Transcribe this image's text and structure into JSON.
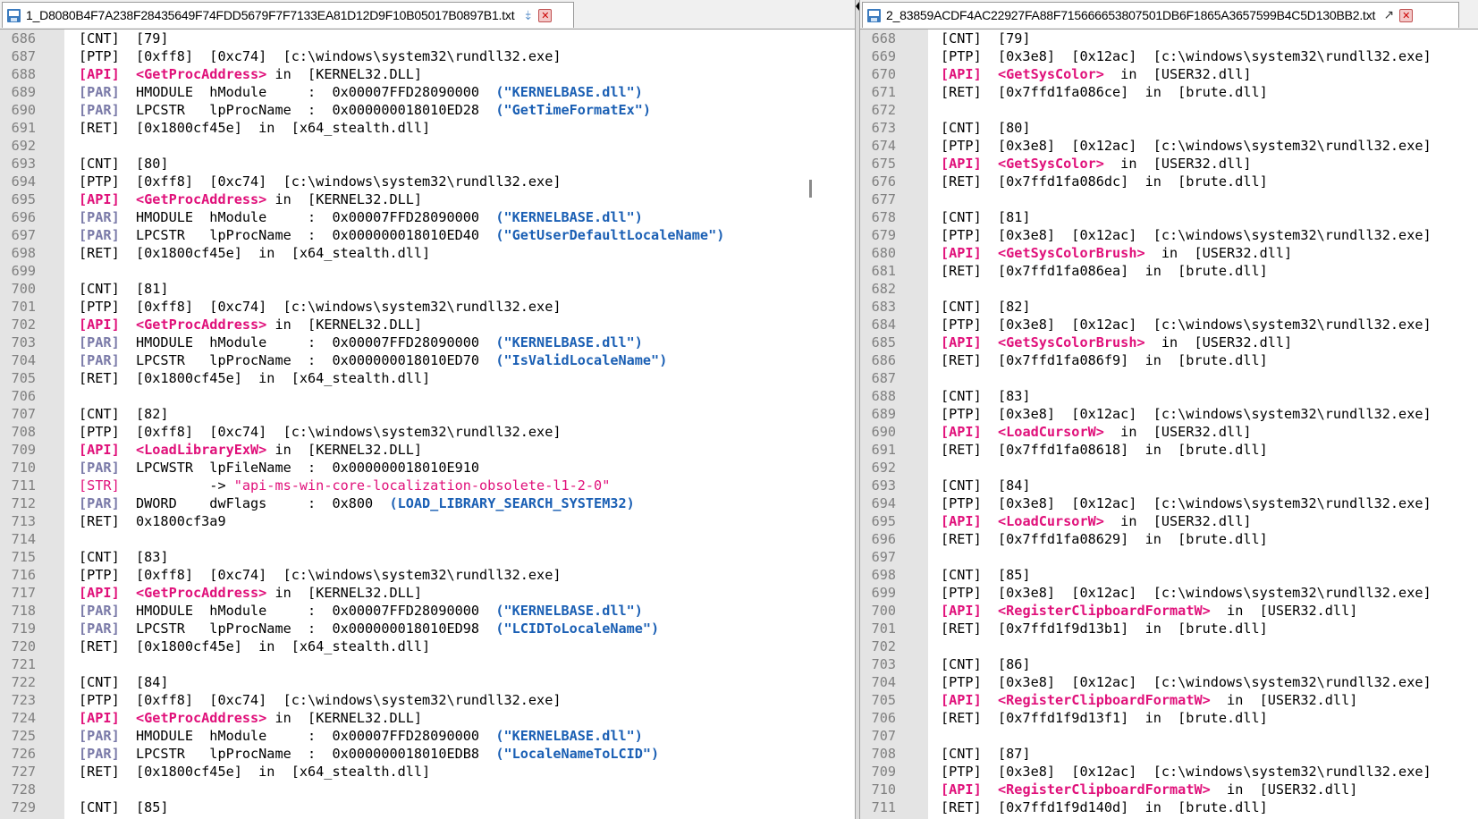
{
  "left": {
    "tab_title": "1_D8080B4F7A238F28435649F74FDD5679F7F7133EA81D12D9F10B05017B0897B1.txt",
    "lines": [
      {
        "n": "686",
        "segs": [
          [
            "t",
            "[CNT]  [79]"
          ]
        ]
      },
      {
        "n": "687",
        "segs": [
          [
            "t",
            "[PTP]  [0xff8]  [0xc74]  [c:\\windows\\system32\\rundll32.exe]"
          ]
        ]
      },
      {
        "n": "688",
        "segs": [
          [
            "api",
            "[API]"
          ],
          [
            "t",
            "  "
          ],
          [
            "fn",
            "<GetProcAddress>"
          ],
          [
            "t",
            " in  [KERNEL32.DLL]"
          ]
        ]
      },
      {
        "n": "689",
        "segs": [
          [
            "par",
            "[PAR]"
          ],
          [
            "t",
            "  HMODULE  hModule     :  0x00007FFD28090000  "
          ],
          [
            "val",
            "(\"KERNELBASE.dll\")"
          ]
        ]
      },
      {
        "n": "690",
        "segs": [
          [
            "par",
            "[PAR]"
          ],
          [
            "t",
            "  LPCSTR   lpProcName  :  0x000000018010ED28  "
          ],
          [
            "val",
            "(\"GetTimeFormatEx\")"
          ]
        ]
      },
      {
        "n": "691",
        "segs": [
          [
            "t",
            "[RET]  [0x1800cf45e]  in  [x64_stealth.dll]"
          ]
        ]
      },
      {
        "n": "692",
        "segs": []
      },
      {
        "n": "693",
        "segs": [
          [
            "t",
            "[CNT]  [80]"
          ]
        ]
      },
      {
        "n": "694",
        "segs": [
          [
            "t",
            "[PTP]  [0xff8]  [0xc74]  [c:\\windows\\system32\\rundll32.exe]"
          ]
        ]
      },
      {
        "n": "695",
        "segs": [
          [
            "api",
            "[API]"
          ],
          [
            "t",
            "  "
          ],
          [
            "fn",
            "<GetProcAddress>"
          ],
          [
            "t",
            " in  [KERNEL32.DLL]"
          ]
        ]
      },
      {
        "n": "696",
        "segs": [
          [
            "par",
            "[PAR]"
          ],
          [
            "t",
            "  HMODULE  hModule     :  0x00007FFD28090000  "
          ],
          [
            "val",
            "(\"KERNELBASE.dll\")"
          ]
        ]
      },
      {
        "n": "697",
        "segs": [
          [
            "par",
            "[PAR]"
          ],
          [
            "t",
            "  LPCSTR   lpProcName  :  0x000000018010ED40  "
          ],
          [
            "val",
            "(\"GetUserDefaultLocaleName\")"
          ]
        ]
      },
      {
        "n": "698",
        "segs": [
          [
            "t",
            "[RET]  [0x1800cf45e]  in  [x64_stealth.dll]"
          ]
        ]
      },
      {
        "n": "699",
        "segs": []
      },
      {
        "n": "700",
        "segs": [
          [
            "t",
            "[CNT]  [81]"
          ]
        ]
      },
      {
        "n": "701",
        "segs": [
          [
            "t",
            "[PTP]  [0xff8]  [0xc74]  [c:\\windows\\system32\\rundll32.exe]"
          ]
        ]
      },
      {
        "n": "702",
        "segs": [
          [
            "api",
            "[API]"
          ],
          [
            "t",
            "  "
          ],
          [
            "fn",
            "<GetProcAddress>"
          ],
          [
            "t",
            " in  [KERNEL32.DLL]"
          ]
        ]
      },
      {
        "n": "703",
        "segs": [
          [
            "par",
            "[PAR]"
          ],
          [
            "t",
            "  HMODULE  hModule     :  0x00007FFD28090000  "
          ],
          [
            "val",
            "(\"KERNELBASE.dll\")"
          ]
        ]
      },
      {
        "n": "704",
        "segs": [
          [
            "par",
            "[PAR]"
          ],
          [
            "t",
            "  LPCSTR   lpProcName  :  0x000000018010ED70  "
          ],
          [
            "val",
            "(\"IsValidLocaleName\")"
          ]
        ]
      },
      {
        "n": "705",
        "segs": [
          [
            "t",
            "[RET]  [0x1800cf45e]  in  [x64_stealth.dll]"
          ]
        ]
      },
      {
        "n": "706",
        "segs": []
      },
      {
        "n": "707",
        "segs": [
          [
            "t",
            "[CNT]  [82]"
          ]
        ]
      },
      {
        "n": "708",
        "segs": [
          [
            "t",
            "[PTP]  [0xff8]  [0xc74]  [c:\\windows\\system32\\rundll32.exe]"
          ]
        ]
      },
      {
        "n": "709",
        "segs": [
          [
            "api",
            "[API]"
          ],
          [
            "t",
            "  "
          ],
          [
            "fn",
            "<LoadLibraryExW>"
          ],
          [
            "t",
            " in  [KERNEL32.DLL]"
          ]
        ]
      },
      {
        "n": "710",
        "segs": [
          [
            "par",
            "[PAR]"
          ],
          [
            "t",
            "  LPCWSTR  lpFileName  :  0x000000018010E910"
          ]
        ]
      },
      {
        "n": "711",
        "segs": [
          [
            "str",
            "[STR]"
          ],
          [
            "t",
            "           -> "
          ],
          [
            "strv",
            "\"api-ms-win-core-localization-obsolete-l1-2-0\""
          ]
        ]
      },
      {
        "n": "712",
        "segs": [
          [
            "par",
            "[PAR]"
          ],
          [
            "t",
            "  DWORD    dwFlags     :  0x800  "
          ],
          [
            "val",
            "(LOAD_LIBRARY_SEARCH_SYSTEM32)"
          ]
        ]
      },
      {
        "n": "713",
        "segs": [
          [
            "t",
            "[RET]  0x1800cf3a9"
          ]
        ]
      },
      {
        "n": "714",
        "segs": []
      },
      {
        "n": "715",
        "segs": [
          [
            "t",
            "[CNT]  [83]"
          ]
        ]
      },
      {
        "n": "716",
        "segs": [
          [
            "t",
            "[PTP]  [0xff8]  [0xc74]  [c:\\windows\\system32\\rundll32.exe]"
          ]
        ]
      },
      {
        "n": "717",
        "segs": [
          [
            "api",
            "[API]"
          ],
          [
            "t",
            "  "
          ],
          [
            "fn",
            "<GetProcAddress>"
          ],
          [
            "t",
            " in  [KERNEL32.DLL]"
          ]
        ]
      },
      {
        "n": "718",
        "segs": [
          [
            "par",
            "[PAR]"
          ],
          [
            "t",
            "  HMODULE  hModule     :  0x00007FFD28090000  "
          ],
          [
            "val",
            "(\"KERNELBASE.dll\")"
          ]
        ]
      },
      {
        "n": "719",
        "segs": [
          [
            "par",
            "[PAR]"
          ],
          [
            "t",
            "  LPCSTR   lpProcName  :  0x000000018010ED98  "
          ],
          [
            "val",
            "(\"LCIDToLocaleName\")"
          ]
        ]
      },
      {
        "n": "720",
        "segs": [
          [
            "t",
            "[RET]  [0x1800cf45e]  in  [x64_stealth.dll]"
          ]
        ]
      },
      {
        "n": "721",
        "segs": []
      },
      {
        "n": "722",
        "segs": [
          [
            "t",
            "[CNT]  [84]"
          ]
        ]
      },
      {
        "n": "723",
        "segs": [
          [
            "t",
            "[PTP]  [0xff8]  [0xc74]  [c:\\windows\\system32\\rundll32.exe]"
          ]
        ]
      },
      {
        "n": "724",
        "segs": [
          [
            "api",
            "[API]"
          ],
          [
            "t",
            "  "
          ],
          [
            "fn",
            "<GetProcAddress>"
          ],
          [
            "t",
            " in  [KERNEL32.DLL]"
          ]
        ]
      },
      {
        "n": "725",
        "segs": [
          [
            "par",
            "[PAR]"
          ],
          [
            "t",
            "  HMODULE  hModule     :  0x00007FFD28090000  "
          ],
          [
            "val",
            "(\"KERNELBASE.dll\")"
          ]
        ]
      },
      {
        "n": "726",
        "segs": [
          [
            "par",
            "[PAR]"
          ],
          [
            "t",
            "  LPCSTR   lpProcName  :  0x000000018010EDB8  "
          ],
          [
            "val",
            "(\"LocaleNameToLCID\")"
          ]
        ]
      },
      {
        "n": "727",
        "segs": [
          [
            "t",
            "[RET]  [0x1800cf45e]  in  [x64_stealth.dll]"
          ]
        ]
      },
      {
        "n": "728",
        "segs": []
      },
      {
        "n": "729",
        "segs": [
          [
            "t",
            "[CNT]  [85]"
          ]
        ]
      }
    ]
  },
  "right": {
    "tab_title": "2_83859ACDF4AC22927FA88F715666653807501DB6F1865A3657599B4C5D130BB2.txt",
    "lines": [
      {
        "n": "668",
        "segs": [
          [
            "t",
            "[CNT]  [79]"
          ]
        ]
      },
      {
        "n": "669",
        "segs": [
          [
            "t",
            "[PTP]  [0x3e8]  [0x12ac]  [c:\\windows\\system32\\rundll32.exe]"
          ]
        ]
      },
      {
        "n": "670",
        "segs": [
          [
            "api",
            "[API]"
          ],
          [
            "t",
            "  "
          ],
          [
            "fn",
            "<GetSysColor>"
          ],
          [
            "t",
            "  in  [USER32.dll]"
          ]
        ]
      },
      {
        "n": "671",
        "segs": [
          [
            "t",
            "[RET]  [0x7ffd1fa086ce]  in  [brute.dll]"
          ]
        ]
      },
      {
        "n": "672",
        "segs": []
      },
      {
        "n": "673",
        "segs": [
          [
            "t",
            "[CNT]  [80]"
          ]
        ]
      },
      {
        "n": "674",
        "segs": [
          [
            "t",
            "[PTP]  [0x3e8]  [0x12ac]  [c:\\windows\\system32\\rundll32.exe]"
          ]
        ]
      },
      {
        "n": "675",
        "segs": [
          [
            "api",
            "[API]"
          ],
          [
            "t",
            "  "
          ],
          [
            "fn",
            "<GetSysColor>"
          ],
          [
            "t",
            "  in  [USER32.dll]"
          ]
        ]
      },
      {
        "n": "676",
        "segs": [
          [
            "t",
            "[RET]  [0x7ffd1fa086dc]  in  [brute.dll]"
          ]
        ]
      },
      {
        "n": "677",
        "segs": []
      },
      {
        "n": "678",
        "segs": [
          [
            "t",
            "[CNT]  [81]"
          ]
        ]
      },
      {
        "n": "679",
        "segs": [
          [
            "t",
            "[PTP]  [0x3e8]  [0x12ac]  [c:\\windows\\system32\\rundll32.exe]"
          ]
        ]
      },
      {
        "n": "680",
        "segs": [
          [
            "api",
            "[API]"
          ],
          [
            "t",
            "  "
          ],
          [
            "fn",
            "<GetSysColorBrush>"
          ],
          [
            "t",
            "  in  [USER32.dll]"
          ]
        ]
      },
      {
        "n": "681",
        "segs": [
          [
            "t",
            "[RET]  [0x7ffd1fa086ea]  in  [brute.dll]"
          ]
        ]
      },
      {
        "n": "682",
        "segs": []
      },
      {
        "n": "683",
        "segs": [
          [
            "t",
            "[CNT]  [82]"
          ]
        ]
      },
      {
        "n": "684",
        "segs": [
          [
            "t",
            "[PTP]  [0x3e8]  [0x12ac]  [c:\\windows\\system32\\rundll32.exe]"
          ]
        ]
      },
      {
        "n": "685",
        "segs": [
          [
            "api",
            "[API]"
          ],
          [
            "t",
            "  "
          ],
          [
            "fn",
            "<GetSysColorBrush>"
          ],
          [
            "t",
            "  in  [USER32.dll]"
          ]
        ]
      },
      {
        "n": "686",
        "segs": [
          [
            "t",
            "[RET]  [0x7ffd1fa086f9]  in  [brute.dll]"
          ]
        ]
      },
      {
        "n": "687",
        "segs": []
      },
      {
        "n": "688",
        "segs": [
          [
            "t",
            "[CNT]  [83]"
          ]
        ]
      },
      {
        "n": "689",
        "segs": [
          [
            "t",
            "[PTP]  [0x3e8]  [0x12ac]  [c:\\windows\\system32\\rundll32.exe]"
          ]
        ]
      },
      {
        "n": "690",
        "segs": [
          [
            "api",
            "[API]"
          ],
          [
            "t",
            "  "
          ],
          [
            "fn",
            "<LoadCursorW>"
          ],
          [
            "t",
            "  in  [USER32.dll]"
          ]
        ]
      },
      {
        "n": "691",
        "segs": [
          [
            "t",
            "[RET]  [0x7ffd1fa08618]  in  [brute.dll]"
          ]
        ]
      },
      {
        "n": "692",
        "segs": []
      },
      {
        "n": "693",
        "segs": [
          [
            "t",
            "[CNT]  [84]"
          ]
        ]
      },
      {
        "n": "694",
        "segs": [
          [
            "t",
            "[PTP]  [0x3e8]  [0x12ac]  [c:\\windows\\system32\\rundll32.exe]"
          ]
        ]
      },
      {
        "n": "695",
        "segs": [
          [
            "api",
            "[API]"
          ],
          [
            "t",
            "  "
          ],
          [
            "fn",
            "<LoadCursorW>"
          ],
          [
            "t",
            "  in  [USER32.dll]"
          ]
        ]
      },
      {
        "n": "696",
        "segs": [
          [
            "t",
            "[RET]  [0x7ffd1fa08629]  in  [brute.dll]"
          ]
        ]
      },
      {
        "n": "697",
        "segs": []
      },
      {
        "n": "698",
        "segs": [
          [
            "t",
            "[CNT]  [85]"
          ]
        ]
      },
      {
        "n": "699",
        "segs": [
          [
            "t",
            "[PTP]  [0x3e8]  [0x12ac]  [c:\\windows\\system32\\rundll32.exe]"
          ]
        ]
      },
      {
        "n": "700",
        "segs": [
          [
            "api",
            "[API]"
          ],
          [
            "t",
            "  "
          ],
          [
            "fn",
            "<RegisterClipboardFormatW>"
          ],
          [
            "t",
            "  in  [USER32.dll]"
          ]
        ]
      },
      {
        "n": "701",
        "segs": [
          [
            "t",
            "[RET]  [0x7ffd1f9d13b1]  in  [brute.dll]"
          ]
        ]
      },
      {
        "n": "702",
        "segs": []
      },
      {
        "n": "703",
        "segs": [
          [
            "t",
            "[CNT]  [86]"
          ]
        ]
      },
      {
        "n": "704",
        "segs": [
          [
            "t",
            "[PTP]  [0x3e8]  [0x12ac]  [c:\\windows\\system32\\rundll32.exe]"
          ]
        ]
      },
      {
        "n": "705",
        "segs": [
          [
            "api",
            "[API]"
          ],
          [
            "t",
            "  "
          ],
          [
            "fn",
            "<RegisterClipboardFormatW>"
          ],
          [
            "t",
            "  in  [USER32.dll]"
          ]
        ]
      },
      {
        "n": "706",
        "segs": [
          [
            "t",
            "[RET]  [0x7ffd1f9d13f1]  in  [brute.dll]"
          ]
        ]
      },
      {
        "n": "707",
        "segs": []
      },
      {
        "n": "708",
        "segs": [
          [
            "t",
            "[CNT]  [87]"
          ]
        ]
      },
      {
        "n": "709",
        "segs": [
          [
            "t",
            "[PTP]  [0x3e8]  [0x12ac]  [c:\\windows\\system32\\rundll32.exe]"
          ]
        ]
      },
      {
        "n": "710",
        "segs": [
          [
            "api",
            "[API]"
          ],
          [
            "t",
            "  "
          ],
          [
            "fn",
            "<RegisterClipboardFormatW>"
          ],
          [
            "t",
            "  in  [USER32.dll]"
          ]
        ]
      },
      {
        "n": "711",
        "segs": [
          [
            "t",
            "[RET]  [0x7ffd1f9d140d]  in  [brute.dll]"
          ]
        ]
      }
    ]
  },
  "icons": {
    "file": "file-icon",
    "pin": "pin-icon",
    "close": "close-icon"
  },
  "colors": {
    "api_tag": "#e0107a",
    "par_tag": "#7a7aa8",
    "value": "#1a5fb4",
    "gutter": "#e4e4e4"
  }
}
